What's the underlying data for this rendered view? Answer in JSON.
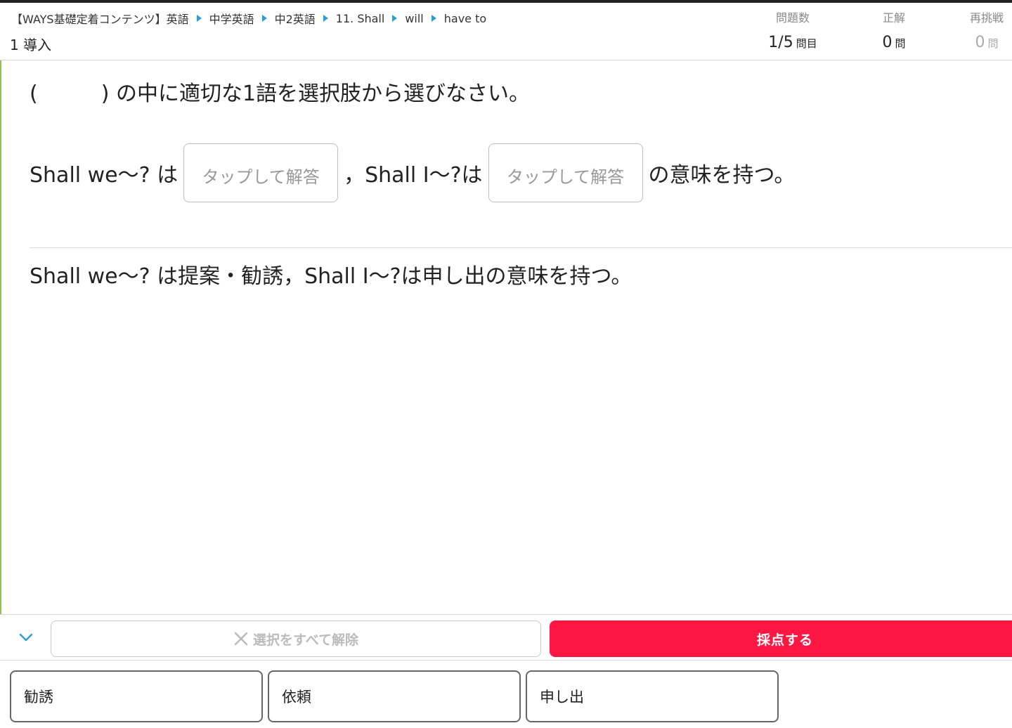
{
  "header": {
    "breadcrumb": [
      "【WAYS基礎定着コンテンツ】英語",
      "中学英語",
      "中2英語",
      "11. Shall",
      "will",
      "have to"
    ],
    "lesson_title": "1 導入",
    "stats": {
      "question_count": {
        "label": "問題数",
        "value": "1/5",
        "unit": "問目"
      },
      "correct": {
        "label": "正解",
        "value": "0",
        "unit": "問"
      },
      "retry": {
        "label": "再挑戦",
        "value": "0",
        "unit": "問"
      }
    }
  },
  "question": {
    "instruction": "(　　　) の中に適切な1語を選択肢から選びなさい。",
    "part1": "Shall we～? は",
    "blank1_placeholder": "タップして解答",
    "part2": "，Shall I～?は",
    "blank2_placeholder": "タップして解答",
    "part3": "の意味を持つ。"
  },
  "explanation": "Shall we～? は提案・勧誘，Shall I～?は申し出の意味を持つ。",
  "actions": {
    "clear_label": "選択をすべて解除",
    "grade_label": "採点する"
  },
  "choices": [
    "勧誘",
    "依頼",
    "申し出"
  ],
  "colors": {
    "accent_red": "#ff1744",
    "breadcrumb_arrow": "#2a9fd6",
    "left_accent": "#8bc34a"
  }
}
